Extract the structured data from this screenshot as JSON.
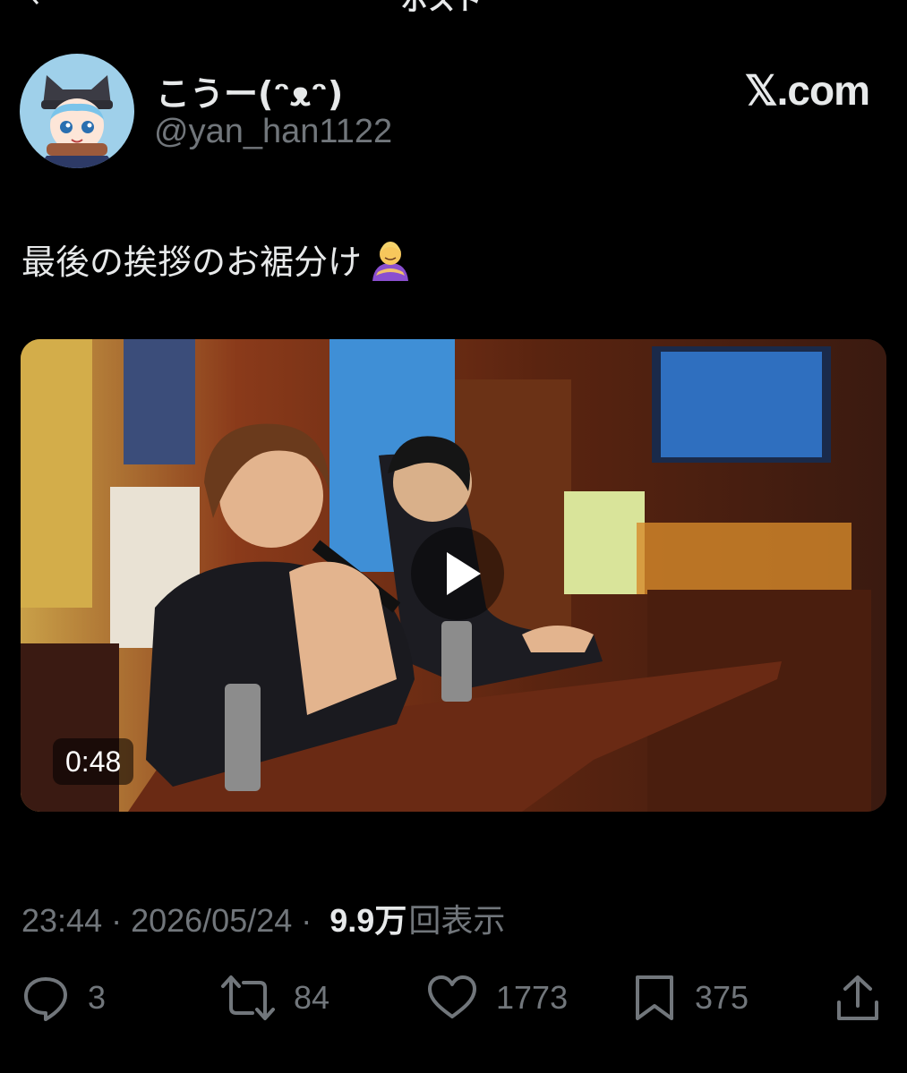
{
  "header": {
    "title": "ポスト",
    "back_icon": "arrow-left-icon"
  },
  "author": {
    "display_name": "こうー(ᵔᴥᵔ)",
    "handle": "@yan_han1122",
    "avatar": "avatar-icon"
  },
  "brand": {
    "label": "𝕏.com"
  },
  "tweet": {
    "text": "最後の挨拶のお裾分け",
    "emoji": "bowing-person-icon"
  },
  "media": {
    "duration": "0:48",
    "play_icon": "play-icon"
  },
  "meta": {
    "time": "23:44",
    "separator": "·",
    "date": "2026/05/24",
    "views_count": "9.9万",
    "views_label": "回表示"
  },
  "actions": {
    "reply": {
      "icon": "reply-icon",
      "count": "3"
    },
    "repost": {
      "icon": "repost-icon",
      "count": "84"
    },
    "like": {
      "icon": "like-icon",
      "count": "1773"
    },
    "bookmark": {
      "icon": "bookmark-icon",
      "count": "375"
    },
    "share": {
      "icon": "share-icon"
    }
  },
  "colors": {
    "background": "#000000",
    "primary_text": "#e7e9ea",
    "secondary_text": "#71767b"
  }
}
